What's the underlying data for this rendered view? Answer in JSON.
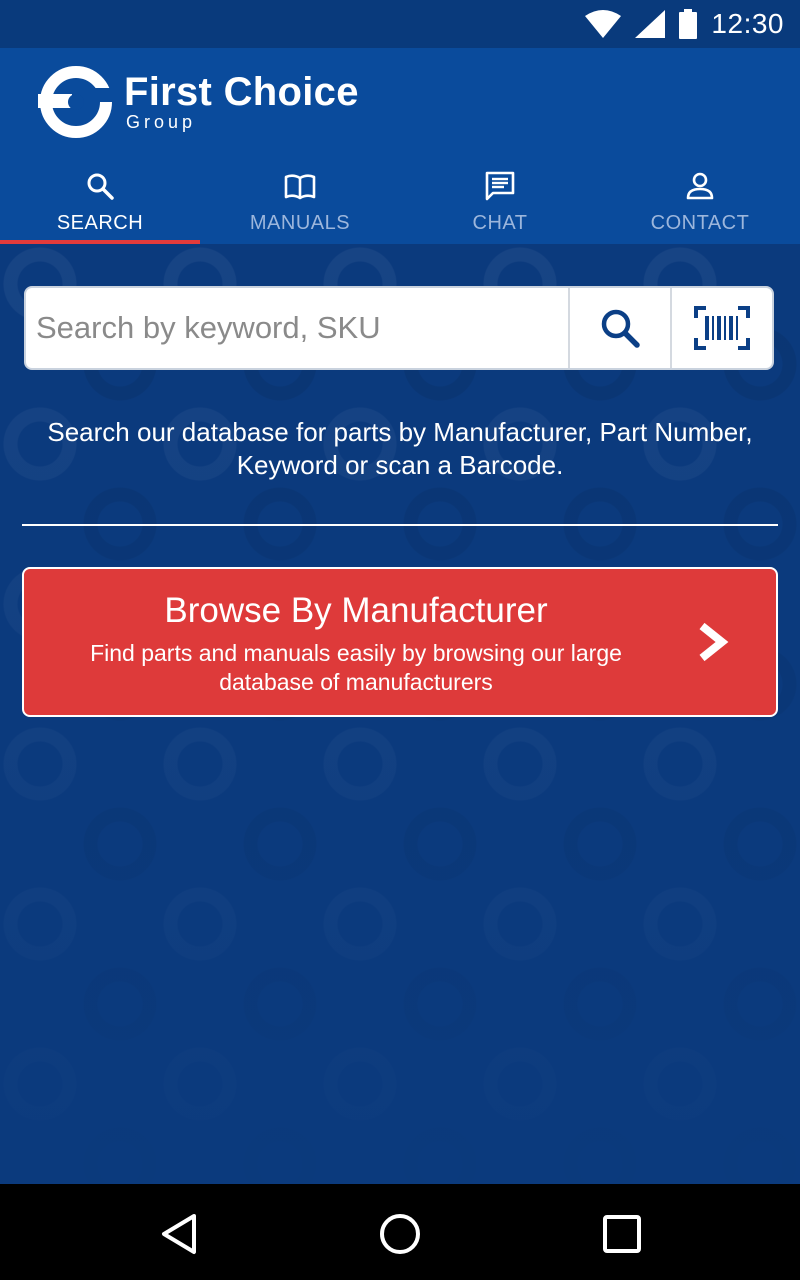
{
  "status_bar": {
    "time": "12:30",
    "icons": [
      "wifi-icon",
      "signal-icon",
      "battery-icon"
    ]
  },
  "header": {
    "logo_title": "First Choice",
    "logo_subtitle": "Group",
    "tabs": [
      {
        "label": "SEARCH",
        "icon": "search-icon",
        "active": true
      },
      {
        "label": "MANUALS",
        "icon": "book-icon",
        "active": false
      },
      {
        "label": "CHAT",
        "icon": "chat-icon",
        "active": false
      },
      {
        "label": "CONTACT",
        "icon": "person-icon",
        "active": false
      }
    ]
  },
  "search": {
    "placeholder": "Search by keyword, SKU",
    "value": ""
  },
  "help_text": "Search our database for parts by Manufacturer, Part Number, Keyword or scan a Barcode.",
  "browse": {
    "title": "Browse By Manufacturer",
    "description": "Find parts and manuals easily by browsing our large database of manufacturers"
  },
  "colors": {
    "header_blue": "#0a4b9c",
    "background_blue": "#0b3a7d",
    "accent_red": "#de3a3a"
  }
}
